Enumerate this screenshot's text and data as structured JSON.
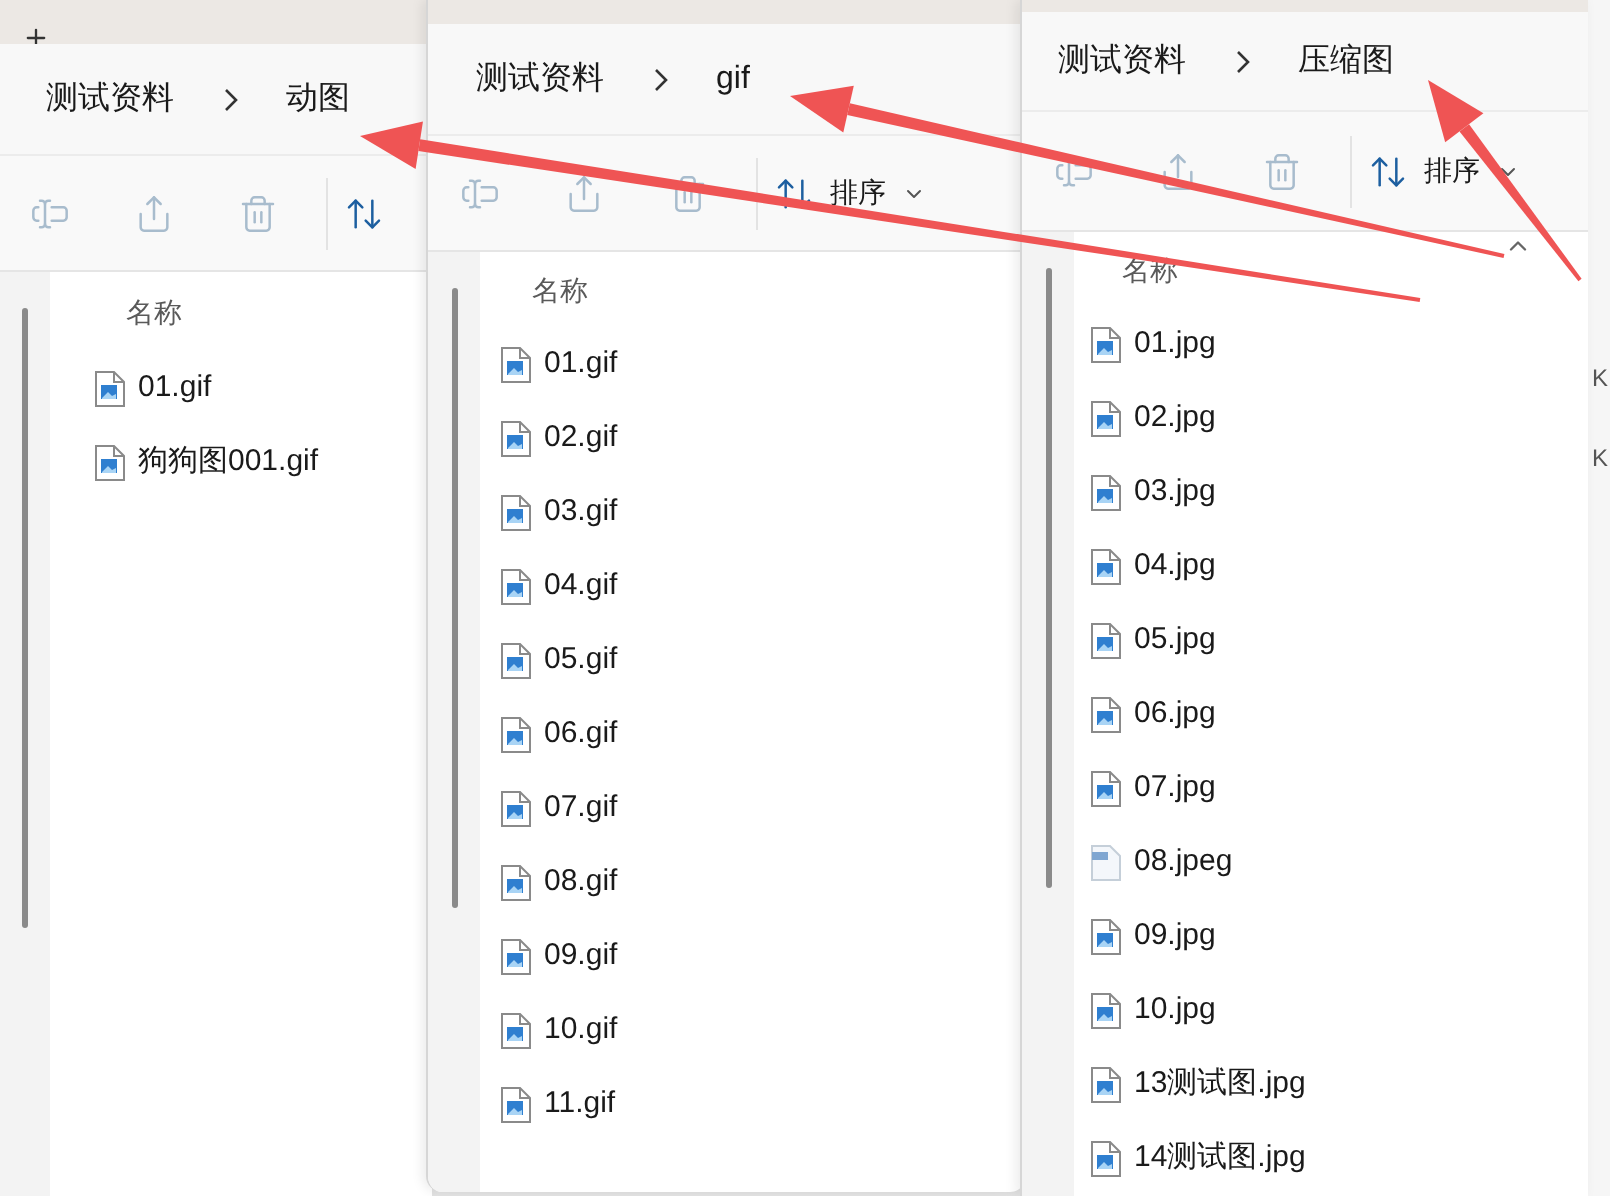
{
  "windows": [
    {
      "breadcrumb": [
        {
          "label": "测试资料"
        },
        {
          "label": "动图"
        }
      ],
      "toolbar": [
        {
          "kind": "rename"
        },
        {
          "kind": "share"
        },
        {
          "kind": "delete"
        },
        {
          "kind": "sort"
        }
      ],
      "column_header": "名称",
      "files": [
        {
          "name": "01.gif",
          "kind": "image"
        },
        {
          "name": "狗狗图001.gif",
          "kind": "image"
        }
      ]
    },
    {
      "breadcrumb": [
        {
          "label": "测试资料"
        },
        {
          "label": "gif"
        }
      ],
      "toolbar": [
        {
          "kind": "rename"
        },
        {
          "kind": "share"
        },
        {
          "kind": "delete"
        },
        {
          "kind": "sort",
          "label": "排序"
        }
      ],
      "column_header": "名称",
      "files": [
        {
          "name": "01.gif",
          "kind": "image"
        },
        {
          "name": "02.gif",
          "kind": "image"
        },
        {
          "name": "03.gif",
          "kind": "image"
        },
        {
          "name": "04.gif",
          "kind": "image"
        },
        {
          "name": "05.gif",
          "kind": "image"
        },
        {
          "name": "06.gif",
          "kind": "image"
        },
        {
          "name": "07.gif",
          "kind": "image"
        },
        {
          "name": "08.gif",
          "kind": "image"
        },
        {
          "name": "09.gif",
          "kind": "image"
        },
        {
          "name": "10.gif",
          "kind": "image"
        },
        {
          "name": "11.gif",
          "kind": "image"
        }
      ]
    },
    {
      "breadcrumb": [
        {
          "label": "测试资料"
        },
        {
          "label": "压缩图"
        }
      ],
      "toolbar": [
        {
          "kind": "rename"
        },
        {
          "kind": "share"
        },
        {
          "kind": "delete"
        },
        {
          "kind": "sort",
          "label": "排序"
        }
      ],
      "column_header": "名称",
      "files": [
        {
          "name": "01.jpg",
          "kind": "image"
        },
        {
          "name": "02.jpg",
          "kind": "image"
        },
        {
          "name": "03.jpg",
          "kind": "image"
        },
        {
          "name": "04.jpg",
          "kind": "image"
        },
        {
          "name": "05.jpg",
          "kind": "image"
        },
        {
          "name": "06.jpg",
          "kind": "image"
        },
        {
          "name": "07.jpg",
          "kind": "image"
        },
        {
          "name": "08.jpeg",
          "kind": "generic"
        },
        {
          "name": "09.jpg",
          "kind": "image"
        },
        {
          "name": "10.jpg",
          "kind": "image"
        },
        {
          "name": "13测试图.jpg",
          "kind": "image"
        },
        {
          "name": "14测试图.jpg",
          "kind": "image"
        }
      ]
    }
  ],
  "background_window": {
    "items": [
      "K",
      "K"
    ]
  }
}
